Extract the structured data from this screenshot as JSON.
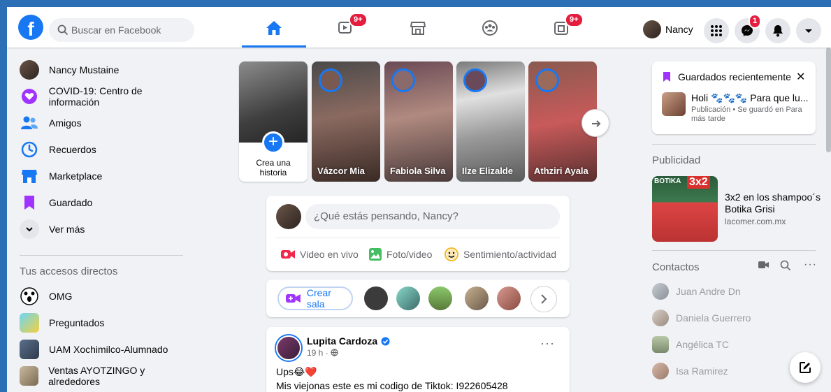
{
  "header": {
    "search_placeholder": "Buscar en Facebook",
    "watch_badge": "9+",
    "gaming_badge": "9+",
    "profile_name": "Nancy",
    "messenger_badge": "1"
  },
  "sidebar": {
    "items": [
      {
        "label": "Nancy Mustaine",
        "icon": "profile-avatar"
      },
      {
        "label": "COVID-19: Centro de información",
        "icon": "covid-heart-icon"
      },
      {
        "label": "Amigos",
        "icon": "friends-icon"
      },
      {
        "label": "Recuerdos",
        "icon": "memories-clock-icon"
      },
      {
        "label": "Marketplace",
        "icon": "marketplace-icon"
      },
      {
        "label": "Guardado",
        "icon": "saved-bookmark-icon"
      },
      {
        "label": "Ver más",
        "icon": "chevron-down-icon"
      }
    ],
    "shortcuts_title": "Tus accesos directos",
    "shortcuts": [
      {
        "label": "OMG"
      },
      {
        "label": "Preguntados"
      },
      {
        "label": "UAM Xochimilco-Alumnado"
      },
      {
        "label": "Ventas AYOTZINGO y alrededores"
      }
    ]
  },
  "stories": {
    "create_label": "Crea una historia",
    "items": [
      {
        "name": "Vázcor Mia"
      },
      {
        "name": "Fabiola Silva"
      },
      {
        "name": "Ilze Elizalde"
      },
      {
        "name": "Athziri Ayala"
      }
    ]
  },
  "composer": {
    "placeholder": "¿Qué estás pensando, Nancy?",
    "actions": [
      "Video en vivo",
      "Foto/video",
      "Sentimiento/actividad"
    ]
  },
  "rooms": {
    "create_label": "Crear sala"
  },
  "post": {
    "author": "Lupita Cardoza",
    "time": "19 h ·",
    "line1": "Ups😂❤️",
    "line2": "Mis viejonas este es mi codigo de Tiktok: I922605428"
  },
  "saved_recent": {
    "title": "Guardados recientemente",
    "item_title": "Holi 🐾🐾🐾 Para que lu...",
    "item_sub": "Publicación • Se guardó en Para más tarde"
  },
  "ads": {
    "section_title": "Publicidad",
    "brand": "BOTIKA",
    "tag": "3x2",
    "title": "3x2 en los shampoo´s Botika Grisi",
    "domain": "lacomer.com.mx"
  },
  "contacts": {
    "section_title": "Contactos",
    "items": [
      {
        "name": "Juan Andre Dn"
      },
      {
        "name": "Daniela Guerrero"
      },
      {
        "name": "Angélica TC"
      },
      {
        "name": "Isa Ramirez"
      }
    ]
  },
  "colors": {
    "brand": "#1877f2",
    "badge": "#e41e3f",
    "background": "#f0f2f5"
  }
}
